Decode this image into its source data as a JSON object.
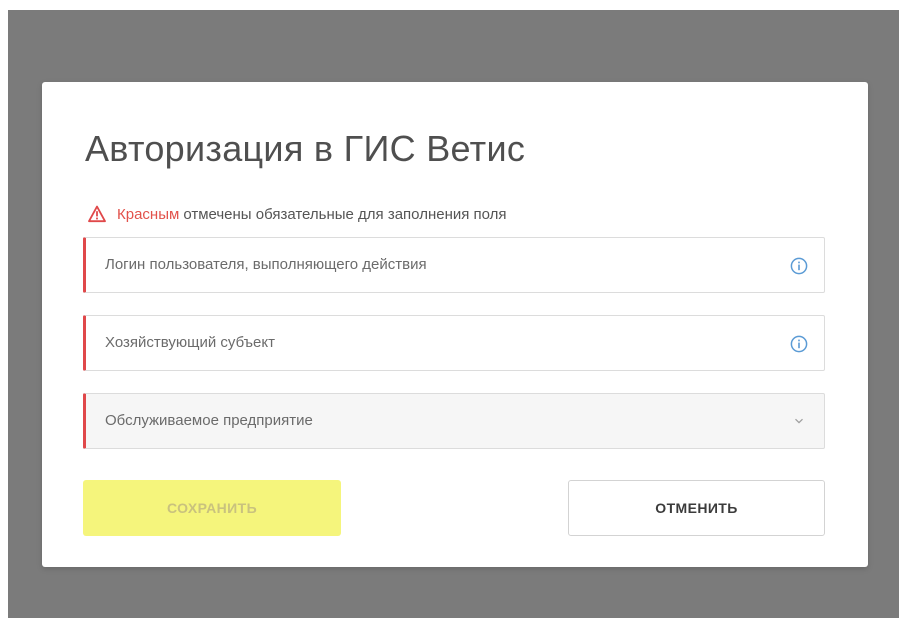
{
  "dialog": {
    "title": "Авторизация в ГИС Ветис",
    "notice": {
      "highlight": "Красным",
      "rest": "отмечены обязательные для заполнения поля",
      "icon": "warning-triangle-icon",
      "highlight_color": "#e2524b"
    },
    "fields": [
      {
        "placeholder": "Логин пользователя, выполняющего действия",
        "icon": "info-icon",
        "required": true
      },
      {
        "placeholder": "Хозяйствующий субъект",
        "icon": "info-icon",
        "required": true
      },
      {
        "placeholder": "Обслуживаемое предприятие",
        "icon": "chevron-down-icon",
        "required": true
      }
    ],
    "buttons": {
      "save_label": "СОХРАНИТЬ",
      "cancel_label": "ОТМЕНИТЬ"
    }
  },
  "colors": {
    "overlay": "#7b7b7b",
    "required_marker": "#e0484a",
    "save_button_bg": "#f5f57c",
    "info_icon": "#5b9bd5"
  }
}
